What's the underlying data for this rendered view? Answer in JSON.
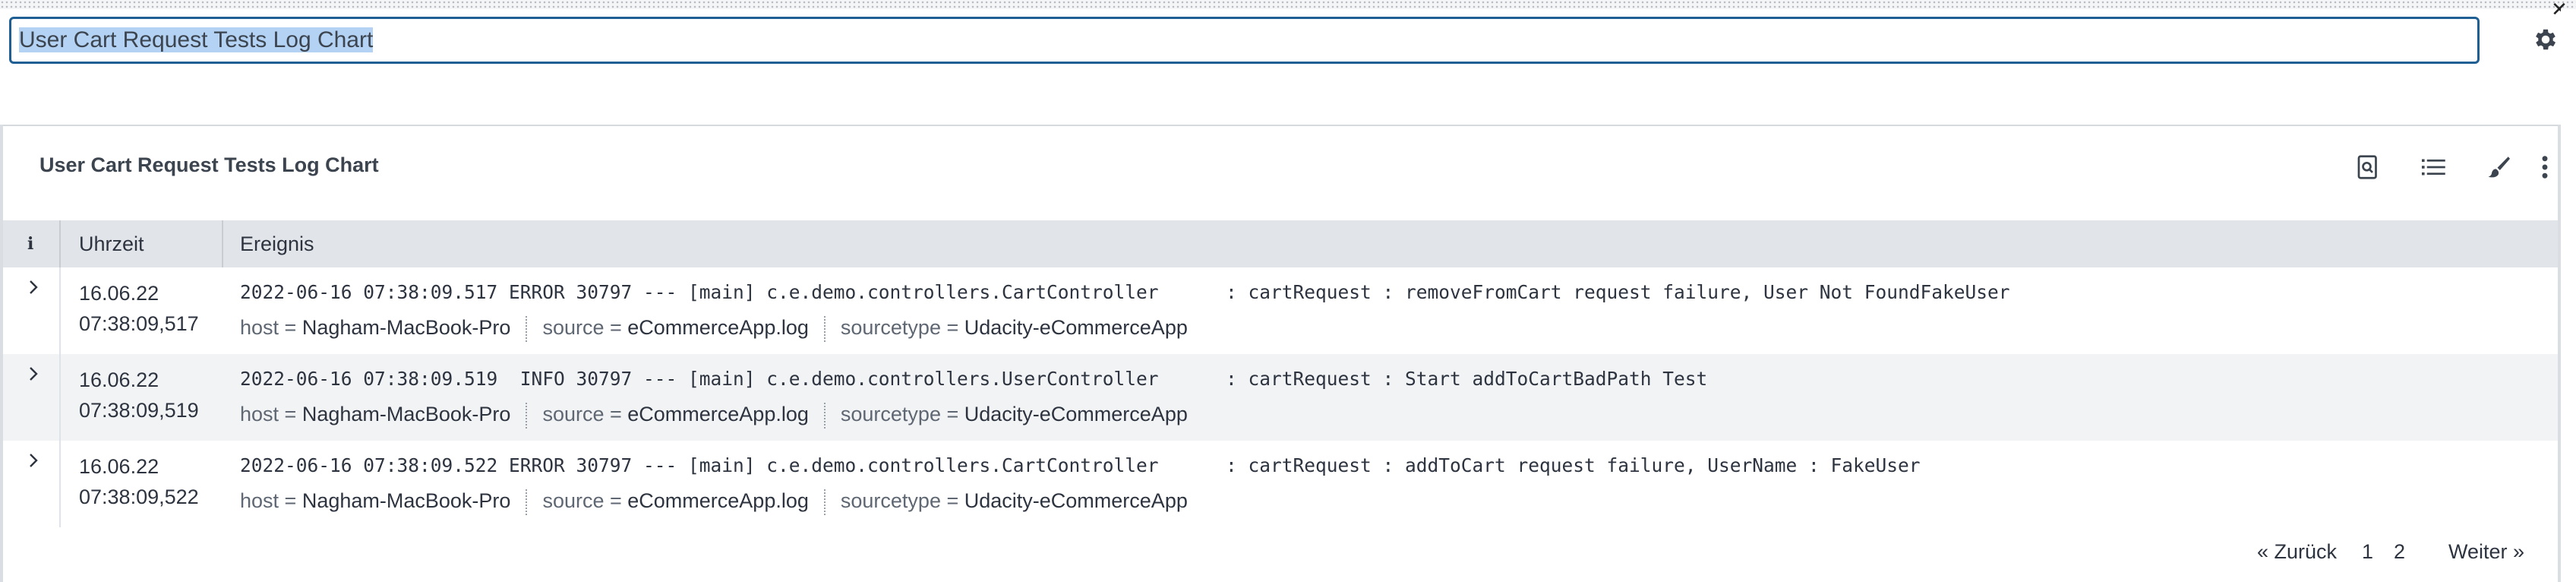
{
  "window": {
    "close_symbol": "✕"
  },
  "title_input": {
    "value": "User Cart Request Tests Log Chart"
  },
  "panel": {
    "title": "User Cart Request Tests Log Chart",
    "tools": [
      "search-document-icon",
      "list-icon",
      "paintbrush-icon",
      "kebab-menu-icon"
    ]
  },
  "table": {
    "headers": {
      "info": "i",
      "time": "Uhrzeit",
      "event": "Ereignis"
    },
    "rows": [
      {
        "date": "16.06.22",
        "time": "07:38:09,517",
        "event": "2022-06-16 07:38:09.517 ERROR 30797 --- [main] c.e.demo.controllers.CartController      : cartRequest : removeFromCart request failure, User Not FoundFakeUser",
        "host_label": "host =",
        "host": "Nagham-MacBook-Pro",
        "source_label": "source =",
        "source": "eCommerceApp.log",
        "sourcetype_label": "sourcetype =",
        "sourcetype": "Udacity-eCommerceApp"
      },
      {
        "date": "16.06.22",
        "time": "07:38:09,519",
        "event": "2022-06-16 07:38:09.519  INFO 30797 --- [main] c.e.demo.controllers.UserController      : cartRequest : Start addToCartBadPath Test",
        "host_label": "host =",
        "host": "Nagham-MacBook-Pro",
        "source_label": "source =",
        "source": "eCommerceApp.log",
        "sourcetype_label": "sourcetype =",
        "sourcetype": "Udacity-eCommerceApp"
      },
      {
        "date": "16.06.22",
        "time": "07:38:09,522",
        "event": "2022-06-16 07:38:09.522 ERROR 30797 --- [main] c.e.demo.controllers.CartController      : cartRequest : addToCart request failure, UserName : FakeUser",
        "host_label": "host =",
        "host": "Nagham-MacBook-Pro",
        "source_label": "source =",
        "source": "eCommerceApp.log",
        "sourcetype_label": "sourcetype =",
        "sourcetype": "Udacity-eCommerceApp"
      }
    ]
  },
  "pager": {
    "prev": "« Zurück",
    "pages": [
      "1",
      "2"
    ],
    "current": "2",
    "next": "Weiter »"
  },
  "colors": {
    "accent": "#1f5f94",
    "header_bg": "#e1e4e8",
    "alt_row_bg": "#f2f3f5",
    "selection": "#b4d3f4"
  }
}
